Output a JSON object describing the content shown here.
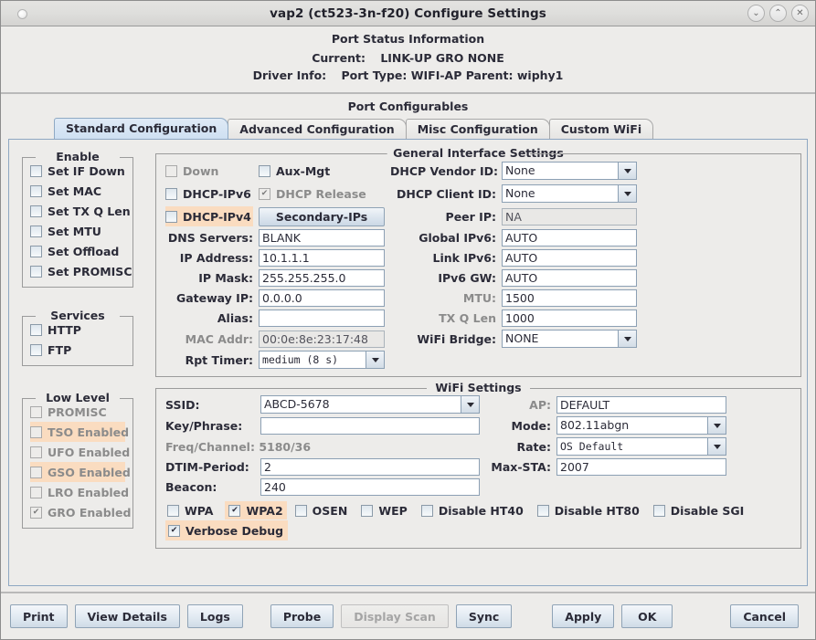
{
  "window": {
    "title": "vap2  (ct523-3n-f20) Configure Settings",
    "controls": [
      {
        "name": "minimize-button",
        "glyph": "⌄"
      },
      {
        "name": "maximize-button",
        "glyph": "⌃"
      },
      {
        "name": "close-button",
        "glyph": "✕"
      }
    ]
  },
  "status": {
    "title": "Port Status Information",
    "current_label": "Current:",
    "current_value": "LINK-UP GRO  NONE",
    "driver_label": "Driver Info:",
    "driver_value": "Port Type: WIFI-AP  Parent: wiphy1"
  },
  "configurables_title": "Port Configurables",
  "tabs": [
    {
      "label": "Standard Configuration",
      "active": true
    },
    {
      "label": "Advanced Configuration",
      "active": false
    },
    {
      "label": "Misc Configuration",
      "active": false
    },
    {
      "label": "Custom WiFi",
      "active": false
    }
  ],
  "enable_group": {
    "title": "Enable",
    "items": [
      {
        "label": "Set IF Down",
        "checked": false
      },
      {
        "label": "Set MAC",
        "checked": false
      },
      {
        "label": "Set TX Q Len",
        "checked": false
      },
      {
        "label": "Set MTU",
        "checked": false
      },
      {
        "label": "Set Offload",
        "checked": false
      },
      {
        "label": "Set PROMISC",
        "checked": false
      }
    ]
  },
  "services_group": {
    "title": "Services",
    "items": [
      {
        "label": "HTTP",
        "checked": false
      },
      {
        "label": "FTP",
        "checked": false
      }
    ]
  },
  "lowlevel_group": {
    "title": "Low Level",
    "items": [
      {
        "label": "PROMISC",
        "checked": false,
        "highlight": false
      },
      {
        "label": "TSO Enabled",
        "checked": false,
        "highlight": true
      },
      {
        "label": "UFO Enabled",
        "checked": false,
        "highlight": false
      },
      {
        "label": "GSO Enabled",
        "checked": false,
        "highlight": true
      },
      {
        "label": "LRO Enabled",
        "checked": false,
        "highlight": false
      },
      {
        "label": "GRO Enabled",
        "checked": true,
        "highlight": false
      }
    ]
  },
  "general": {
    "title": "General Interface Settings",
    "down_label": "Down",
    "aux_mgt_label": "Aux-Mgt",
    "dhcp_ipv6_label": "DHCP-IPv6",
    "dhcp_release_label": "DHCP Release",
    "dhcp_ipv4_label": "DHCP-IPv4",
    "secondary_ips_button": "Secondary-IPs",
    "dns_servers_label": "DNS Servers:",
    "dns_servers_value": "BLANK",
    "ip_address_label": "IP Address:",
    "ip_address_value": "10.1.1.1",
    "ip_mask_label": "IP Mask:",
    "ip_mask_value": "255.255.255.0",
    "gateway_label": "Gateway IP:",
    "gateway_value": "0.0.0.0",
    "alias_label": "Alias:",
    "alias_value": "",
    "mac_addr_label": "MAC Addr:",
    "mac_addr_value": "00:0e:8e:23:17:48",
    "rpt_timer_label": "Rpt Timer:",
    "rpt_timer_value": "medium  (8 s)",
    "dhcp_vendor_label": "DHCP Vendor ID:",
    "dhcp_vendor_value": "None",
    "dhcp_client_label": "DHCP Client ID:",
    "dhcp_client_value": "None",
    "peer_ip_label": "Peer IP:",
    "peer_ip_value": "NA",
    "global_ipv6_label": "Global IPv6:",
    "global_ipv6_value": "AUTO",
    "link_ipv6_label": "Link IPv6:",
    "link_ipv6_value": "AUTO",
    "ipv6_gw_label": "IPv6 GW:",
    "ipv6_gw_value": "AUTO",
    "mtu_label": "MTU:",
    "mtu_value": "1500",
    "txqlen_label": "TX Q Len",
    "txqlen_value": "1000",
    "wifi_bridge_label": "WiFi Bridge:",
    "wifi_bridge_value": "NONE"
  },
  "wifi": {
    "title": "WiFi Settings",
    "ssid_label": "SSID:",
    "ssid_value": "ABCD-5678",
    "ap_label": "AP:",
    "ap_value": "DEFAULT",
    "key_label": "Key/Phrase:",
    "key_value": "",
    "mode_label": "Mode:",
    "mode_value": "802.11abgn",
    "freq_channel": "Freq/Channel: 5180/36",
    "rate_label": "Rate:",
    "rate_value": "OS Default",
    "dtim_label": "DTIM-Period:",
    "dtim_value": "2",
    "maxsta_label": "Max-STA:",
    "maxsta_value": "2007",
    "beacon_label": "Beacon:",
    "beacon_value": "240",
    "security_checks": [
      {
        "label": "WPA",
        "checked": false,
        "highlight": false
      },
      {
        "label": "WPA2",
        "checked": true,
        "highlight": true
      },
      {
        "label": "OSEN",
        "checked": false,
        "highlight": false
      },
      {
        "label": "WEP",
        "checked": false,
        "highlight": false
      },
      {
        "label": "Disable HT40",
        "checked": false,
        "highlight": false
      },
      {
        "label": "Disable HT80",
        "checked": false,
        "highlight": false
      },
      {
        "label": "Disable SGI",
        "checked": false,
        "highlight": false
      }
    ],
    "verbose_debug": {
      "label": "Verbose Debug",
      "checked": true,
      "highlight": true
    }
  },
  "buttons": {
    "print": "Print",
    "view_details": "View Details",
    "logs": "Logs",
    "probe": "Probe",
    "display_scan": "Display Scan",
    "sync": "Sync",
    "apply": "Apply",
    "ok": "OK",
    "cancel": "Cancel"
  },
  "colors": {
    "highlight": "#fadcc0",
    "panel": "#edecea",
    "tab_active": "#cfe0f2",
    "field_border": "#8ca0b4"
  }
}
